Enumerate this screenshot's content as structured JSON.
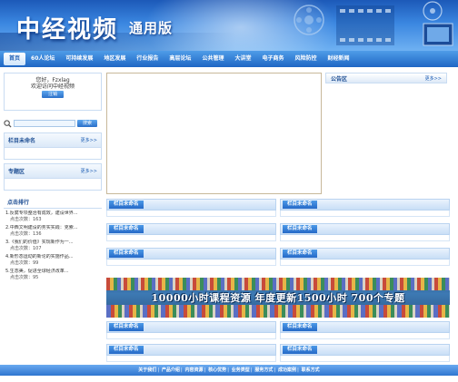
{
  "header": {
    "brand": "中经视频",
    "edition": "通用版"
  },
  "nav": {
    "items": [
      {
        "label": "首页",
        "active": true
      },
      {
        "label": "60人论坛"
      },
      {
        "label": "可持续发展"
      },
      {
        "label": "地区发展"
      },
      {
        "label": "行业报告"
      },
      {
        "label": "高层论坛"
      },
      {
        "label": "公共管理"
      },
      {
        "label": "大讲堂"
      },
      {
        "label": "电子商务"
      },
      {
        "label": "风险防控"
      },
      {
        "label": "财经新闻"
      }
    ]
  },
  "login": {
    "greeting": "您好，Fzxlag",
    "welcome": "欢迎访问中经视频",
    "button_label": "注销"
  },
  "search": {
    "button_label": "搜索"
  },
  "sidebar": {
    "box1": {
      "title": "栏目未命名",
      "more": "更多>>"
    },
    "box2": {
      "title": "专题区",
      "more": "更多>>"
    }
  },
  "ranking": {
    "title": "点击排行",
    "items": [
      {
        "title": "1.反腐专项整治有成效，建设世界...",
        "count": "点击次数：163"
      },
      {
        "title": "2.中西文明建设的务实实践：克索...",
        "count": "点击次数：136"
      },
      {
        "title": "3.《我们的价值》实现新作为一...",
        "count": "点击次数：107"
      },
      {
        "title": "4.新形态运动的新论的实施作品...",
        "count": "点击次数：99"
      },
      {
        "title": "5.生态美，促进全球经济改革...",
        "count": "点击次数：95"
      }
    ]
  },
  "notice": {
    "title": "公告区",
    "more": "更多>>"
  },
  "columns": {
    "r1_left": "栏目未命名",
    "r1_right": "栏目未命名",
    "r2_left": "栏目未命名",
    "r2_right": "栏目未命名",
    "r3_left": "栏目未命名",
    "r3_right": "栏目未命名",
    "r4_left": "栏目未命名",
    "r4_right": "栏目未命名",
    "r5_left": "栏目未命名",
    "r5_right": "栏目未命名"
  },
  "promo": {
    "text": "10000小时课程资源 年度更新1500小时 700个专题"
  },
  "footer": {
    "links": [
      "关于我们",
      "产品介绍",
      "内容资源",
      "核心优势",
      "业务类型",
      "服务方式",
      "成功案例",
      "联系方式"
    ]
  },
  "colors": {
    "nav_blue": "#1f66c4",
    "accent": "#4c9ae8"
  }
}
